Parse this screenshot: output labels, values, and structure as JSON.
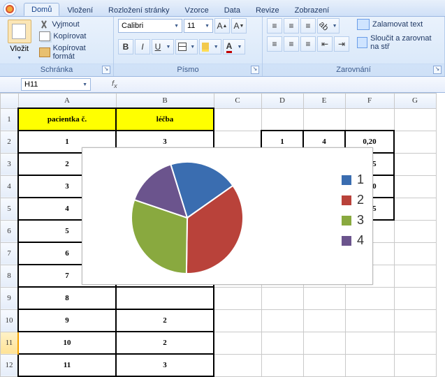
{
  "tabs": {
    "t0": "Domů",
    "t1": "Vložení",
    "t2": "Rozložení stránky",
    "t3": "Vzorce",
    "t4": "Data",
    "t5": "Revize",
    "t6": "Zobrazení"
  },
  "clipboard": {
    "paste": "Vložit",
    "cut": "Vyjmout",
    "copy": "Kopírovat",
    "fmt": "Kopírovat formát",
    "label": "Schránka"
  },
  "font": {
    "name": "Calibri",
    "size": "11",
    "label": "Písmo"
  },
  "align": {
    "wrap": "Zalamovat text",
    "merge": "Sloučit a zarovnat na stř",
    "label": "Zarovnání"
  },
  "namebox": "H11",
  "cols": {
    "A": "A",
    "B": "B",
    "C": "C",
    "D": "D",
    "E": "E",
    "F": "F",
    "G": "G"
  },
  "rows": {
    "r1": "1",
    "r2": "2",
    "r3": "3",
    "r4": "4",
    "r5": "5",
    "r6": "6",
    "r7": "7",
    "r8": "8",
    "r9": "9",
    "r10": "10",
    "r11": "11",
    "r12": "12"
  },
  "cells": {
    "A1": "pacientka č.",
    "B1": "léčba",
    "A2": "1",
    "B2": "3",
    "D2": "1",
    "E2": "4",
    "F2": "0,20",
    "A3": "2",
    "F3": "0,35",
    "A4": "3",
    "F4": "0,30",
    "A5": "4",
    "F5": "0,15",
    "A6": "5",
    "A7": "6",
    "A8": "7",
    "A9": "8",
    "A10": "9",
    "B10": "2",
    "A11": "10",
    "B11": "2",
    "A12": "11",
    "B12": "3"
  },
  "chart_data": {
    "type": "pie",
    "categories": [
      "1",
      "2",
      "3",
      "4"
    ],
    "values": [
      0.2,
      0.35,
      0.3,
      0.15
    ],
    "colors": [
      "#3a6db0",
      "#b9423a",
      "#89a93f",
      "#6b548d"
    ],
    "title": "",
    "legend_position": "right"
  }
}
